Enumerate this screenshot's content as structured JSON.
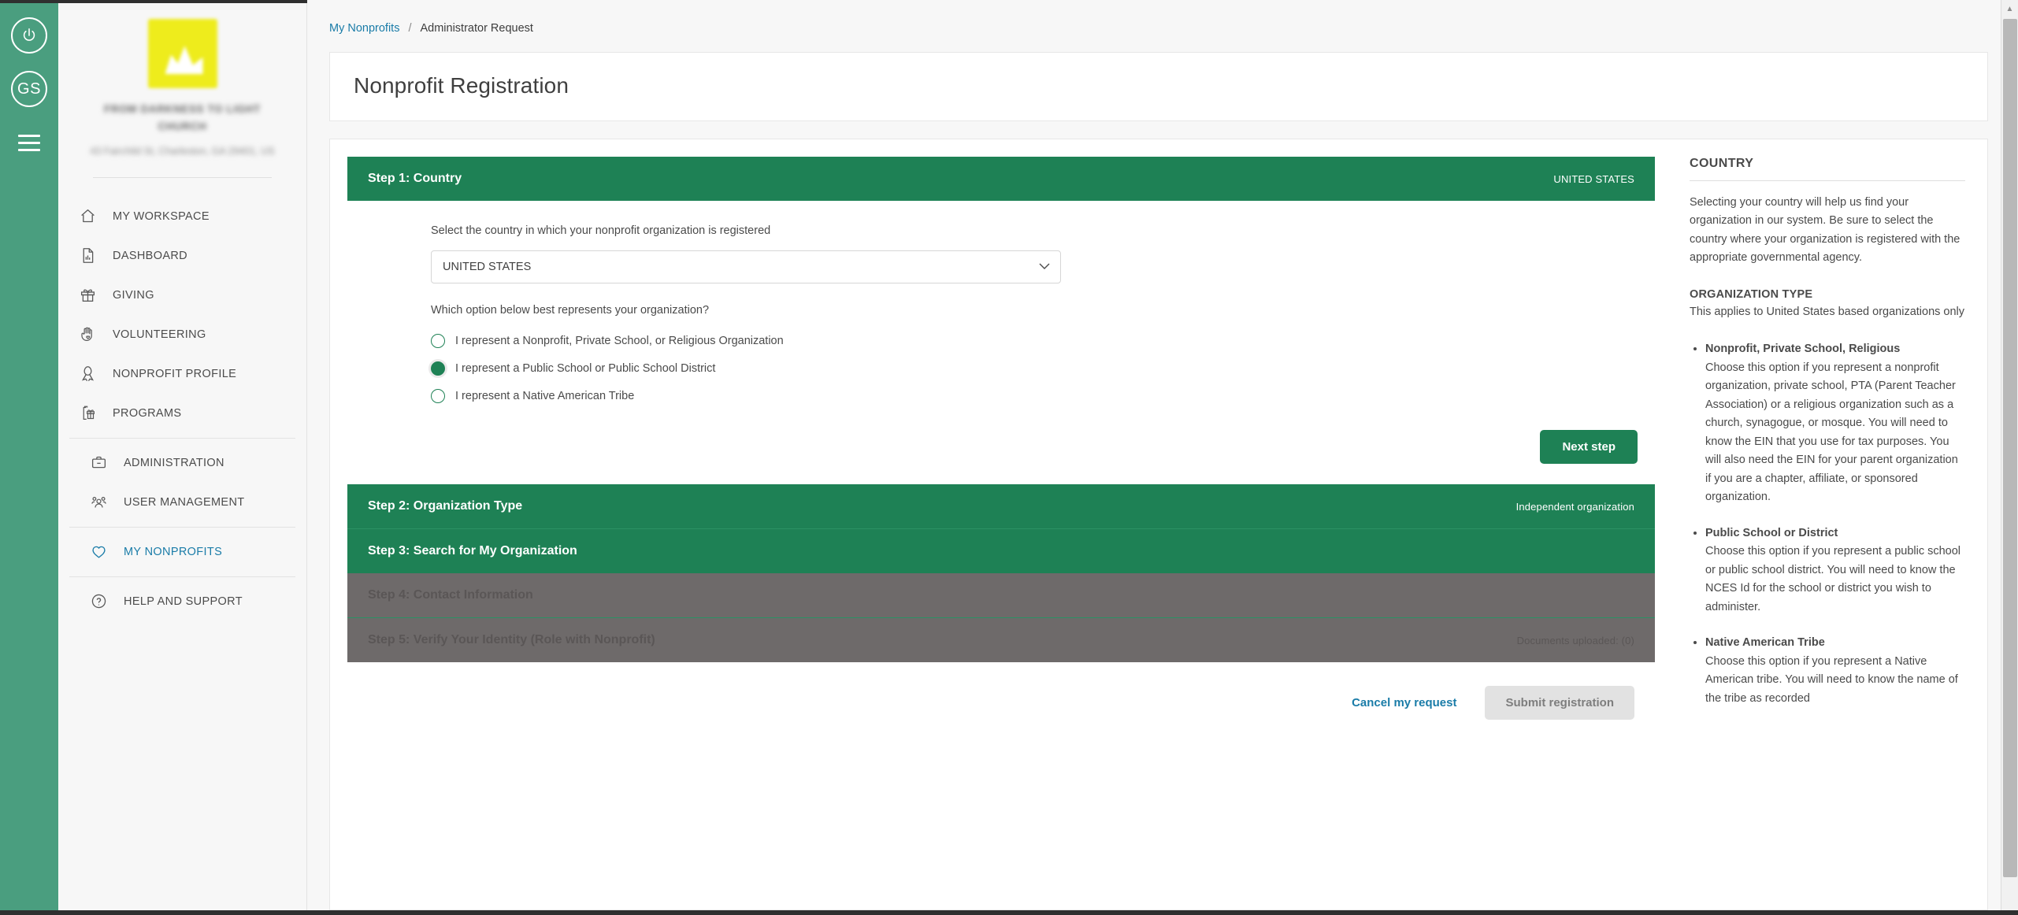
{
  "rail": {
    "power_icon": "power-icon",
    "avatar_initials": "GS",
    "menu_icon": "hamburger-menu-icon"
  },
  "org": {
    "logo_icon": "organization-logo",
    "name": "FROM DARKNESS TO LIGHT CHURCH",
    "address": "43 Fairchild St, Charleston, GA 29401, US"
  },
  "sidebar": {
    "groups": [
      {
        "items": [
          {
            "label": "MY WORKSPACE",
            "icon": "home-icon",
            "active": false
          },
          {
            "label": "DASHBOARD",
            "icon": "report-icon",
            "active": false
          },
          {
            "label": "GIVING",
            "icon": "gift-icon",
            "active": false
          },
          {
            "label": "VOLUNTEERING",
            "icon": "hand-heart-icon",
            "active": false
          },
          {
            "label": "NONPROFIT PROFILE",
            "icon": "ribbon-icon",
            "active": false
          },
          {
            "label": "PROGRAMS",
            "icon": "clipboard-gift-icon",
            "active": false
          }
        ]
      },
      {
        "items": [
          {
            "label": "ADMINISTRATION",
            "icon": "briefcase-icon",
            "active": false
          },
          {
            "label": "USER MANAGEMENT",
            "icon": "users-icon",
            "active": false
          }
        ]
      },
      {
        "items": [
          {
            "label": "MY NONPROFITS",
            "icon": "heart-icon",
            "active": true
          }
        ]
      },
      {
        "items": [
          {
            "label": "HELP AND SUPPORT",
            "icon": "question-circle-icon",
            "active": false
          }
        ]
      }
    ]
  },
  "breadcrumb": {
    "root": "My Nonprofits",
    "separator": "/",
    "current": "Administrator Request"
  },
  "header": {
    "title": "Nonprofit Registration"
  },
  "form": {
    "step1": {
      "label": "Step 1: Country",
      "meta": "UNITED STATES",
      "country_prompt": "Select the country in which your nonprofit organization is registered",
      "country_value": "UNITED STATES",
      "country_options": [
        "UNITED STATES"
      ],
      "caret_icon": "chevron-down-icon",
      "org_question": "Which option below best represents your organization?",
      "options": [
        {
          "label": "I represent a Nonprofit, Private School, or Religious Organization",
          "selected": false
        },
        {
          "label": "I represent a Public School or Public School District",
          "selected": true
        },
        {
          "label": "I represent a Native American Tribe",
          "selected": false
        }
      ],
      "next_label": "Next step"
    },
    "step2": {
      "label": "Step 2: Organization Type",
      "meta": "Independent organization",
      "disabled": false
    },
    "step3": {
      "label": "Step 3: Search for My Organization",
      "meta": "",
      "disabled": false
    },
    "step4": {
      "label": "Step 4: Contact Information",
      "meta": "",
      "disabled": true
    },
    "step5": {
      "label": "Step 5: Verify Your Identity (Role with Nonprofit)",
      "meta": "Documents uploaded: (0)",
      "disabled": true
    },
    "cancel_label": "Cancel my request",
    "submit_label": "Submit registration"
  },
  "help": {
    "country_heading": "COUNTRY",
    "country_text": "Selecting your country will help us find your organization in our system. Be sure to select the country where your organization is registered with the appropriate governmental agency.",
    "orgtype_heading": "ORGANIZATION TYPE",
    "orgtype_text": "This applies to United States based organizations only",
    "bullets": [
      {
        "title": "Nonprofit, Private School, Religious",
        "text": "Choose this option if you represent a nonprofit organization, private school, PTA (Parent Teacher Association) or a religious organization such as a church, synagogue, or mosque. You will need to know the EIN that you use for tax purposes. You will also need the EIN for your parent organization if you are a chapter, affiliate, or sponsored organization."
      },
      {
        "title": "Public School or District",
        "text": "Choose this option if you represent a public school or public school district. You will need to know the NCES Id for the school or district you wish to administer."
      },
      {
        "title": "Native American Tribe",
        "text": "Choose this option if you represent a Native American tribe. You will need to know the name of the tribe as recorded"
      }
    ]
  },
  "colors": {
    "brand_green": "#1e8155",
    "rail_green": "#4a9e7f",
    "link_blue": "#1a7ca8",
    "disabled_gray": "#6e6a6a"
  },
  "scrollbar": {
    "up_arrow_icon": "scroll-up-arrow-icon"
  }
}
